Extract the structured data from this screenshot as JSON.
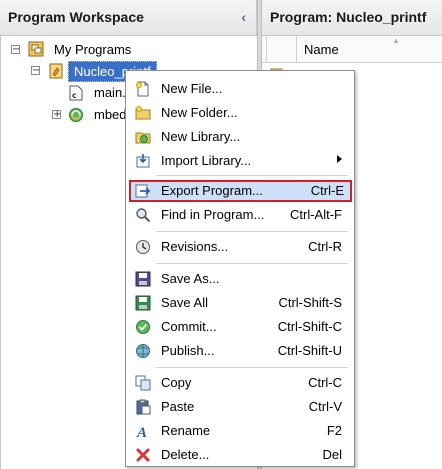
{
  "left_panel": {
    "title": "Program Workspace",
    "collapse_glyph": "‹"
  },
  "right_panel": {
    "title": "Program: Nucleo_printf",
    "column_name": "Name"
  },
  "tree": {
    "root": {
      "label": "My Programs",
      "expander": "−",
      "icon": "programs-folder-icon"
    },
    "program": {
      "label": "Nucleo_printf",
      "expander": "−",
      "icon": "program-icon",
      "selected": true
    },
    "file": {
      "label": "main.c",
      "icon": "c-file-icon"
    },
    "library": {
      "label": "mbed",
      "expander": "+",
      "icon": "library-icon"
    }
  },
  "menu": {
    "items": [
      {
        "label": "New File...",
        "shortcut": "",
        "icon": "new-file-icon"
      },
      {
        "label": "New Folder...",
        "shortcut": "",
        "icon": "new-folder-icon"
      },
      {
        "label": "New Library...",
        "shortcut": "",
        "icon": "new-library-icon"
      },
      {
        "label": "Import Library...",
        "shortcut": "",
        "icon": "import-library-icon",
        "submenu": true
      },
      {
        "label": "Export Program...",
        "shortcut": "Ctrl-E",
        "icon": "export-icon",
        "highlighted": true
      },
      {
        "label": "Find in Program...",
        "shortcut": "Ctrl-Alt-F",
        "icon": "find-icon"
      },
      {
        "label": "Revisions...",
        "shortcut": "Ctrl-R",
        "icon": "revisions-icon"
      },
      {
        "label": "Save As...",
        "shortcut": "",
        "icon": "save-as-icon"
      },
      {
        "label": "Save All",
        "shortcut": "Ctrl-Shift-S",
        "icon": "save-all-icon"
      },
      {
        "label": "Commit...",
        "shortcut": "Ctrl-Shift-C",
        "icon": "commit-icon"
      },
      {
        "label": "Publish...",
        "shortcut": "Ctrl-Shift-U",
        "icon": "publish-icon"
      },
      {
        "label": "Copy",
        "shortcut": "Ctrl-C",
        "icon": "copy-icon"
      },
      {
        "label": "Paste",
        "shortcut": "Ctrl-V",
        "icon": "paste-icon"
      },
      {
        "label": "Rename",
        "shortcut": "F2",
        "icon": "rename-icon"
      },
      {
        "label": "Delete...",
        "shortcut": "Del",
        "icon": "delete-icon"
      }
    ]
  },
  "colors": {
    "selection_bg": "#3a6fc9",
    "highlight_bg": "#cde0f7",
    "highlight_border": "#d21f26"
  }
}
